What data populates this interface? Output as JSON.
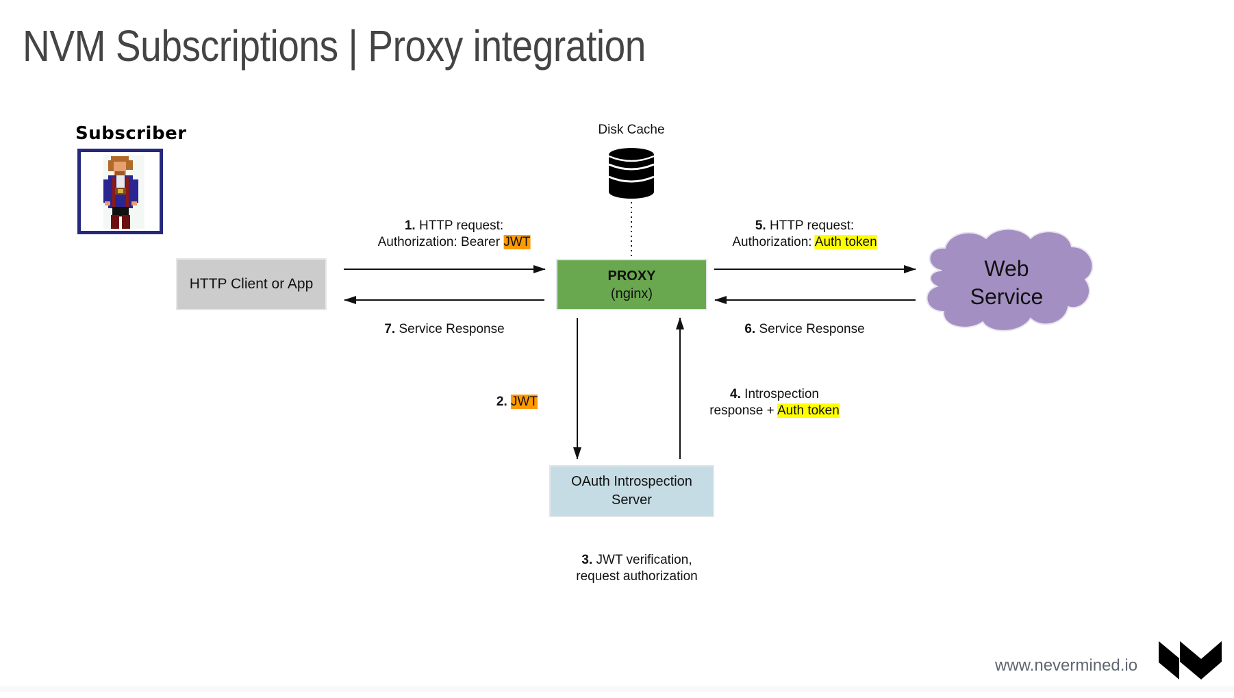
{
  "slide": {
    "title": "NVM Subscriptions | Proxy integration",
    "footer_url": "www.nevermined.io",
    "logo": "nevermined-logo-icon"
  },
  "colors": {
    "title_text": "#444444",
    "proxy_fill": "#6aa84f",
    "client_fill": "#cccccc",
    "oauth_fill": "#c6dce4",
    "cloud_fill": "#a38fc2",
    "jwt_highlight": "#ff9900",
    "auth_token_highlight": "#ffff00",
    "avatar_frame": "#26287e"
  },
  "subscriber": {
    "label": "Subscriber",
    "avatar_icon": "pirate-character-avatar"
  },
  "nodes": {
    "http_client": "HTTP Client or App",
    "proxy": {
      "title": "PROXY",
      "subtitle": "(nginx)"
    },
    "disk_cache": {
      "label": "Disk Cache",
      "icon": "database-icon"
    },
    "web_service": {
      "line1": "Web",
      "line2": "Service"
    },
    "oauth": {
      "line1": "OAuth Introspection",
      "line2": "Server"
    }
  },
  "steps": {
    "s1": {
      "num": "1.",
      "line1": "HTTP request:",
      "line2_prefix": "Authorization: Bearer ",
      "highlight": "JWT"
    },
    "s2": {
      "num": "2.",
      "highlight": "JWT"
    },
    "s3": {
      "num": "3.",
      "line1": "JWT verification,",
      "line2": "request authorization"
    },
    "s4": {
      "num": "4.",
      "line1": "Introspection",
      "line2_prefix": "response + ",
      "highlight": "Auth token"
    },
    "s5": {
      "num": "5.",
      "line1": "HTTP request:",
      "line2_prefix": "Authorization: ",
      "highlight": "Auth token"
    },
    "s6": {
      "num": "6.",
      "text": "Service Response"
    },
    "s7": {
      "num": "7.",
      "text": "Service Response"
    }
  }
}
